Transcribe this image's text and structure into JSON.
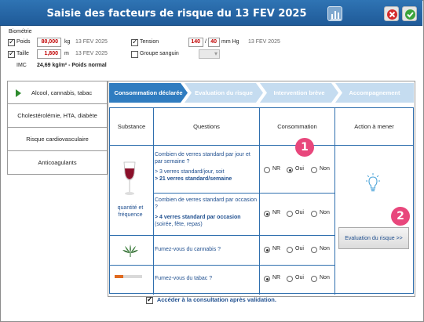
{
  "header": {
    "title": "Saisie des facteurs de risque du 13 FEV 2025"
  },
  "icons": {
    "chart": "bar-chart-icon",
    "close": "close-icon",
    "validate": "check-icon",
    "glass": "wine-glass-icon",
    "leaf": "cannabis-leaf-icon",
    "bulb": "light-bulb-icon"
  },
  "biometrie": {
    "heading": "Biométrie",
    "poids": {
      "label": "Poids",
      "value": "80,000",
      "unit": "kg",
      "date": "13 FEV 2025",
      "checked": true
    },
    "taille": {
      "label": "Taille",
      "value": "1,800",
      "unit": "m",
      "date": "13 FEV 2025",
      "checked": true
    },
    "tension": {
      "label": "Tension",
      "systolic": "140",
      "separator": "/",
      "diastolic": "40",
      "unit": "mm Hg",
      "date": "13 FEV 2025",
      "checked": true
    },
    "groupe": {
      "label": "Groupe sanguin",
      "checked": false
    },
    "imc": {
      "label": "IMC",
      "value": "24,69 kg/m² - Poids normal"
    }
  },
  "sidebar": {
    "items": [
      {
        "label": "Alcool, cannabis, tabac",
        "active": true
      },
      {
        "label": "Cholestérolémie, HTA, diabète"
      },
      {
        "label": "Risque cardiovasculaire"
      },
      {
        "label": "Anticoagulants"
      }
    ]
  },
  "steps": [
    "Consommation déclarée",
    "Evaluation du risque",
    "Intervention brève",
    "Accompagnement"
  ],
  "table": {
    "headers": [
      "Substance",
      "Questions",
      "Consommation",
      "Action à mener"
    ],
    "alcohol_label": "quantité et fréquence",
    "radio_labels": [
      "NR",
      "Oui",
      "Non"
    ],
    "rows": [
      {
        "question": "Combien de verres standard par jour et par semaine ?",
        "detail": "> 3 verres standard/jour, soit",
        "highlight": "> 21 verres standard/semaine",
        "selected": "Oui"
      },
      {
        "question": "Combien de verres standard par occasion ?",
        "highlight": "> 4 verres standard par occasion",
        "note": "(soirée, fête, repas)",
        "selected": "NR"
      },
      {
        "question": "Fumez-vous du cannabis ?",
        "selected": "NR"
      },
      {
        "question": "Fumez-vous du tabac ?",
        "selected": "NR"
      }
    ],
    "tobacco_level": 0.3
  },
  "action": {
    "button": "Evaluation du risque >>"
  },
  "badges": [
    "1",
    "2"
  ],
  "footer": {
    "label": "Accéder à la consultation après validation."
  },
  "colors": {
    "titlebar": "#2f74b4",
    "accent": "#2f7cc0",
    "badge": "#e8477c",
    "value_red": "#c00000"
  }
}
